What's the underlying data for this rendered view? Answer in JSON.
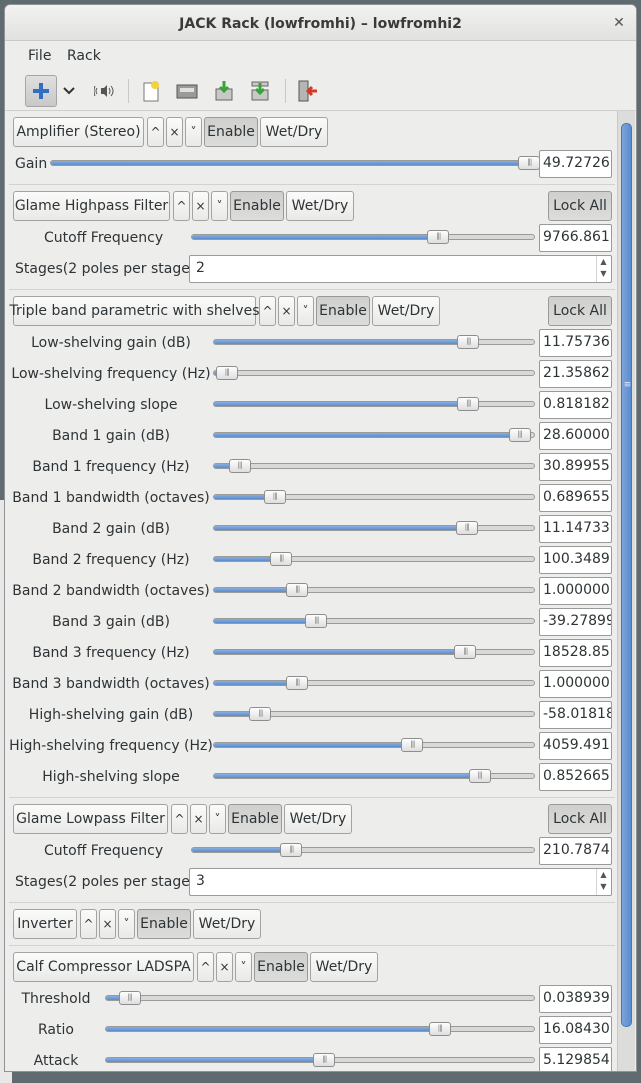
{
  "window": {
    "title": "JACK Rack (lowfromhi) – lowfromhi2"
  },
  "menu": [
    "File",
    "Rack"
  ],
  "toolbar": {
    "icons": [
      "add-icon",
      "chevron-down-icon",
      "speaker-icon",
      "new-icon",
      "open-icon",
      "save-icon",
      "save-as-icon",
      "quit-icon"
    ]
  },
  "common": {
    "up": "^",
    "close": "×",
    "down": "˅",
    "enable": "Enable",
    "wetdry": "Wet/Dry",
    "lock_all": "Lock All"
  },
  "plugins": {
    "amplifier": {
      "name": "Amplifier (Stereo)",
      "controls": [
        {
          "label": "Gain",
          "value": "49.72726",
          "level": 0.99
        }
      ]
    },
    "highpass": {
      "name": "Glame Highpass Filter",
      "controls": [
        {
          "label": "Cutoff Frequency",
          "value": "9766.861",
          "level": 0.72
        }
      ],
      "stages": {
        "label": "Stages(2 poles per stage)",
        "value": "2"
      }
    },
    "triple": {
      "name": "Triple band parametric with shelves",
      "controls": [
        {
          "label": "Low-shelving gain (dB)",
          "value": "11.75736",
          "level": 0.795
        },
        {
          "label": "Low-shelving frequency (Hz)",
          "value": "21.35862",
          "level": 0.04
        },
        {
          "label": "Low-shelving slope",
          "value": "0.818182",
          "level": 0.795
        },
        {
          "label": "Band 1 gain (dB)",
          "value": "28.60000",
          "level": 0.955
        },
        {
          "label": "Band 1 frequency (Hz)",
          "value": "30.89955",
          "level": 0.08
        },
        {
          "label": "Band 1 bandwidth (octaves)",
          "value": "0.689655",
          "level": 0.19
        },
        {
          "label": "Band 2 gain (dB)",
          "value": "11.14733",
          "level": 0.79
        },
        {
          "label": "Band 2 frequency (Hz)",
          "value": "100.3489",
          "level": 0.21
        },
        {
          "label": "Band 2 bandwidth (octaves)",
          "value": "1.000000",
          "level": 0.26
        },
        {
          "label": "Band 3 gain (dB)",
          "value": "-39.27899",
          "level": 0.32
        },
        {
          "label": "Band 3 frequency (Hz)",
          "value": "18528.85",
          "level": 0.785
        },
        {
          "label": "Band 3 bandwidth (octaves)",
          "value": "1.000000",
          "level": 0.26
        },
        {
          "label": "High-shelving gain (dB)",
          "value": "-58.01818",
          "level": 0.145
        },
        {
          "label": "High-shelving frequency (Hz)",
          "value": "4059.491",
          "level": 0.62
        },
        {
          "label": "High-shelving slope",
          "value": "0.852665",
          "level": 0.83
        }
      ]
    },
    "lowpass": {
      "name": "Glame Lowpass Filter",
      "controls": [
        {
          "label": "Cutoff Frequency",
          "value": "210.7874",
          "level": 0.29
        }
      ],
      "stages": {
        "label": "Stages(2 poles per stage)",
        "value": "3"
      }
    },
    "inverter": {
      "name": "Inverter"
    },
    "calf": {
      "name": "Calf Compressor LADSPA",
      "controls": [
        {
          "label": "Threshold",
          "value": "0.038939",
          "level": 0.055
        },
        {
          "label": "Ratio",
          "value": "16.08430",
          "level": 0.78
        },
        {
          "label": "Attack",
          "value": "5.129854",
          "level": 0.51
        }
      ]
    }
  }
}
